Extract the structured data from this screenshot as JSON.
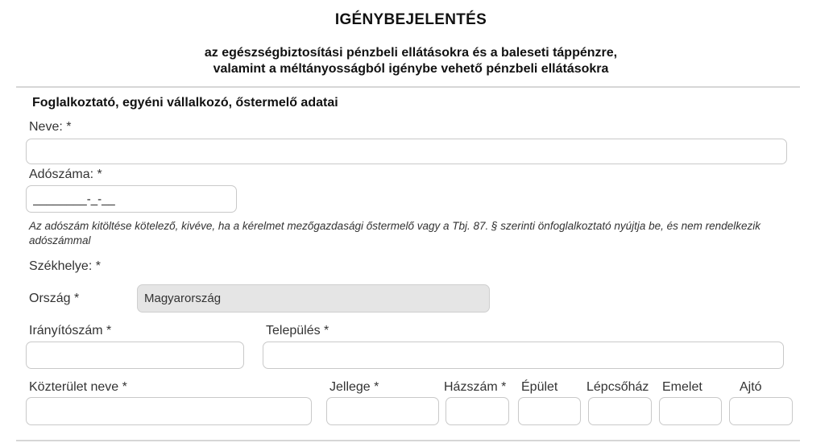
{
  "form": {
    "title": "IGÉNYBEJELENTÉS",
    "subtitle_line1": "az egészségbiztosítási pénzbeli ellátásokra és a baleseti táppénzre,",
    "subtitle_line2": "valamint a méltányosságból igénybe vehető pénzbeli ellátásokra"
  },
  "employer": {
    "section_title": "Foglalkoztató, egyéni vállalkozó, őstermelő adatai",
    "name_label": "Neve: *",
    "name_value": "",
    "tax_label": "Adószáma: *",
    "tax_value": "________-_-__",
    "tax_note": "Az adószám kitöltése kötelező, kivéve, ha a kérelmet mezőgazdasági őstermelő vagy a Tbj. 87. § szerinti önfoglalkoztató nyújtja be, és nem rendelkezik adószámmal",
    "seat_label": "Székhelye: *"
  },
  "address": {
    "country_label": "Ország *",
    "country_value": "Magyarország",
    "zip_label": "Irányítószám *",
    "zip_value": "",
    "city_label": "Település *",
    "city_value": "",
    "street_label": "Közterület neve *",
    "street_value": "",
    "type_label": "Jellege *",
    "type_value": "",
    "number_label": "Házszám *",
    "number_value": "",
    "building_label": "Épület",
    "building_value": "",
    "stair_label": "Lépcsőház",
    "stair_value": "",
    "floor_label": "Emelet",
    "floor_value": "",
    "door_label": "Ajtó",
    "door_value": ""
  }
}
